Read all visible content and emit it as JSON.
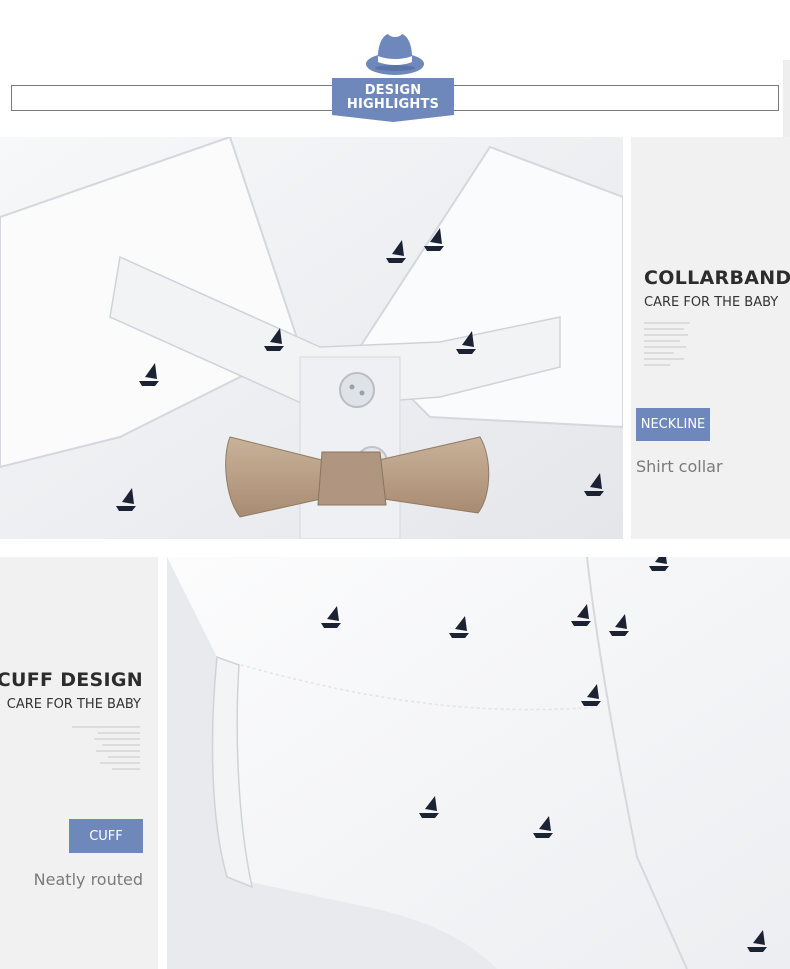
{
  "header": {
    "badge_line1": "DESIGN",
    "badge_line2": "HIGHLIGHTS",
    "icon": "hat-icon",
    "accent_color": "#6f88bb"
  },
  "collar_section": {
    "title": "COLLARBAND",
    "subtitle": "CARE FOR THE BABY",
    "tag": "NECKLINE",
    "caption": "Shirt collar"
  },
  "cuff_section": {
    "title": "CUFF DESIGN",
    "subtitle": "CARE FOR THE BABY",
    "tag": "CUFF",
    "caption": "Neatly routed"
  }
}
